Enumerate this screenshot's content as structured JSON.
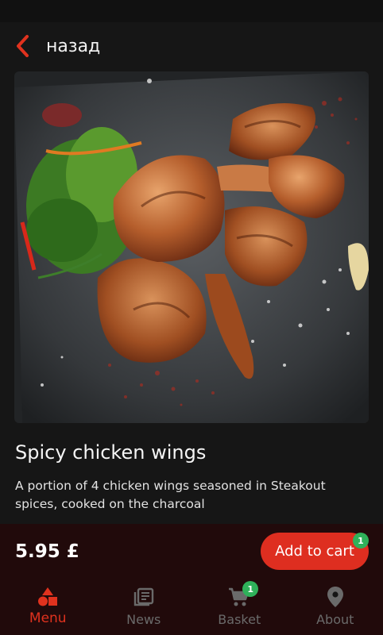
{
  "header": {
    "back_label": "назад"
  },
  "product": {
    "title": "Spicy chicken wings",
    "description": "A portion of 4 chicken wings seasoned in Steakout spices, cooked on the charcoal",
    "price": "5.95 £",
    "add_to_cart_label": "Add to cart",
    "cart_count_badge": "1"
  },
  "nav": {
    "items": [
      {
        "label": "Menu",
        "icon": "menu-shapes-icon",
        "active": true
      },
      {
        "label": "News",
        "icon": "news-icon",
        "active": false
      },
      {
        "label": "Basket",
        "icon": "basket-icon",
        "active": false,
        "badge": "1"
      },
      {
        "label": "About",
        "icon": "location-pin-icon",
        "active": false
      }
    ]
  },
  "colors": {
    "accent": "#de2e20",
    "badge": "#2fb15a",
    "background": "#161616",
    "footer": "#210a0b",
    "inactive": "#6a6a6a"
  }
}
